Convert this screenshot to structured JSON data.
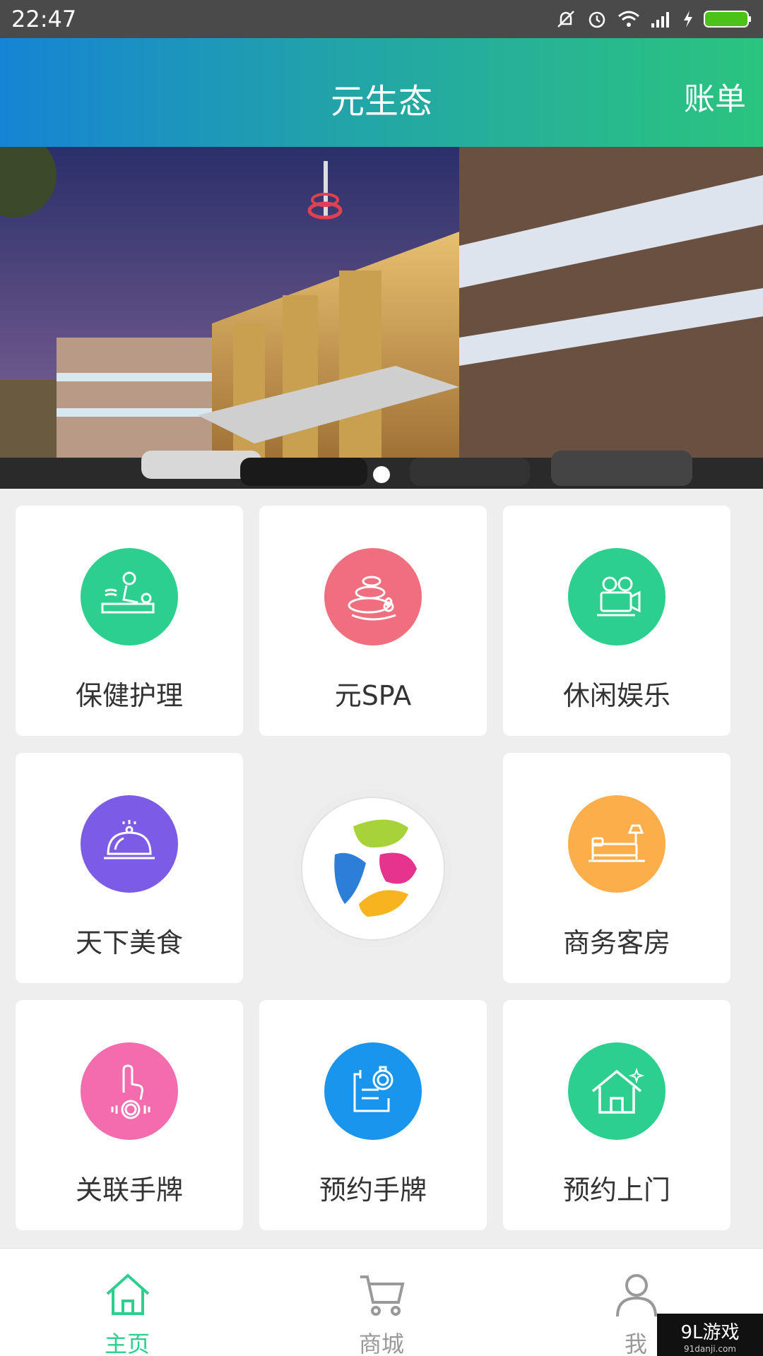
{
  "status_bar": {
    "time": "22:47",
    "icons": [
      "mute-icon",
      "alarm-icon",
      "wifi-icon",
      "signal-icon",
      "charging-icon",
      "battery-icon"
    ]
  },
  "header": {
    "title": "元生态",
    "bill_label": "账单"
  },
  "banner": {
    "slide_count": 1,
    "active_index": 0
  },
  "tiles": [
    {
      "label": "保健护理",
      "icon": "massage-icon",
      "color": "#2ccf8e"
    },
    {
      "label": "元SPA",
      "icon": "spa-stones-icon",
      "color": "#f06e7e"
    },
    {
      "label": "休闲娱乐",
      "icon": "projector-icon",
      "color": "#2ccf8e"
    },
    {
      "label": "天下美食",
      "icon": "food-cloche-icon",
      "color": "#7c5be6"
    },
    {
      "label": "商务客房",
      "icon": "bed-icon",
      "color": "#fcae4a"
    },
    {
      "label": "关联手牌",
      "icon": "tap-bracelet-icon",
      "color": "#f46cae"
    },
    {
      "label": "预约手牌",
      "icon": "booking-bracelet-icon",
      "color": "#1a95ee"
    },
    {
      "label": "预约上门",
      "icon": "house-icon",
      "color": "#2ccf8e"
    }
  ],
  "nav": [
    {
      "label": "主页",
      "icon": "home-icon",
      "active": true
    },
    {
      "label": "商城",
      "icon": "cart-icon",
      "active": false
    },
    {
      "label": "我",
      "icon": "user-icon",
      "active": false
    }
  ],
  "colors": {
    "active": "#2ccf8e",
    "inactive": "#999999"
  },
  "watermark": {
    "brand": "9L游戏",
    "site": "91danji.com"
  }
}
